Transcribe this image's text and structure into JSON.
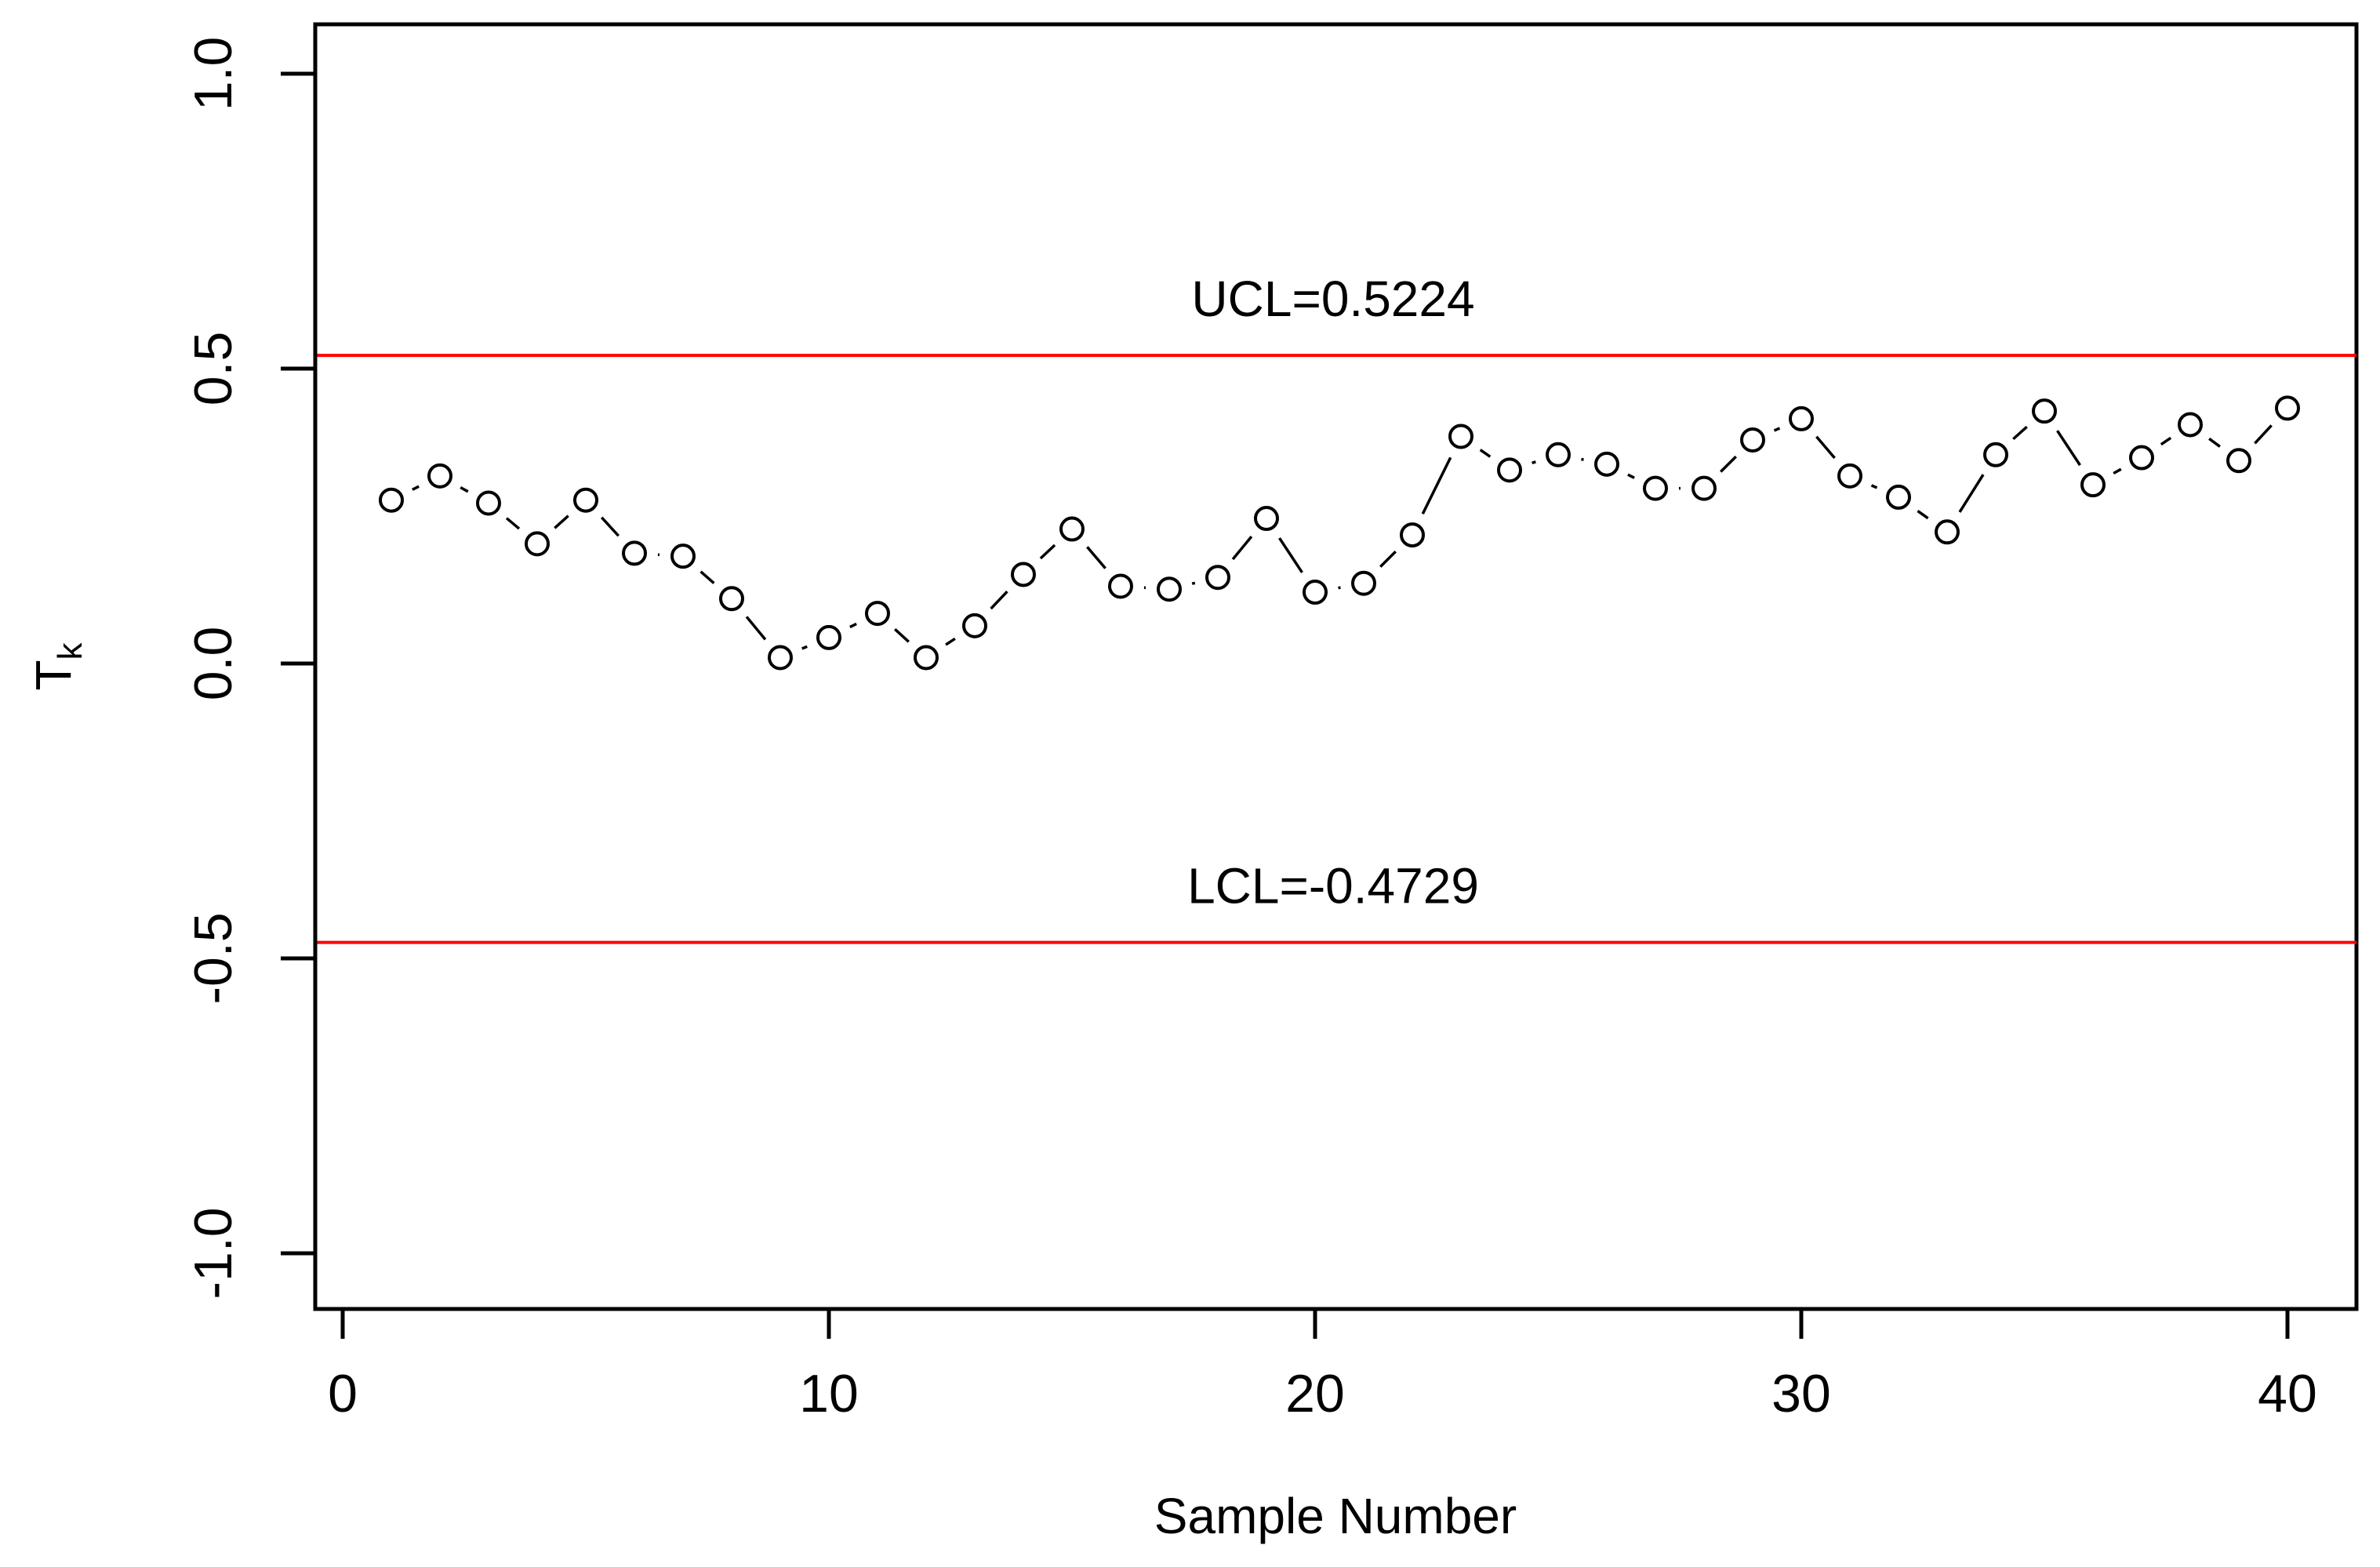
{
  "chart_data": {
    "type": "line",
    "title": "",
    "xlabel": "Sample Number",
    "ylabel": "T",
    "ylabel_subscript": "k",
    "xlim": [
      -0.6,
      41.3
    ],
    "ylim": [
      -1.08,
      1.07
    ],
    "x_ticks": [
      0,
      10,
      20,
      30,
      40
    ],
    "x_tick_labels": [
      "0",
      "10",
      "20",
      "30",
      "40"
    ],
    "y_ticks": [
      -1.0,
      -0.5,
      0.0,
      0.5,
      1.0
    ],
    "y_tick_labels": [
      "-1.0",
      "-0.5",
      "0.0",
      "0.5",
      "1.0"
    ],
    "grid": false,
    "series": [
      {
        "name": "T_k",
        "style": "points-and-lines",
        "marker": "open-circle",
        "color": "#000000",
        "x": [
          1,
          2,
          3,
          4,
          5,
          6,
          7,
          8,
          9,
          10,
          11,
          12,
          13,
          14,
          15,
          16,
          17,
          18,
          19,
          20,
          21,
          22,
          23,
          24,
          25,
          26,
          27,
          28,
          29,
          30,
          31,
          32,
          33,
          34,
          35,
          36,
          37,
          38,
          39,
          40
        ],
        "values": [
          0.277,
          0.318,
          0.272,
          0.203,
          0.277,
          0.187,
          0.182,
          0.11,
          0.01,
          0.044,
          0.085,
          0.01,
          0.064,
          0.151,
          0.228,
          0.131,
          0.126,
          0.146,
          0.246,
          0.121,
          0.136,
          0.218,
          0.385,
          0.328,
          0.354,
          0.338,
          0.297,
          0.297,
          0.379,
          0.415,
          0.318,
          0.282,
          0.223,
          0.354,
          0.428,
          0.303,
          0.349,
          0.405,
          0.344,
          0.433
        ]
      }
    ],
    "control_limits": [
      {
        "name": "UCL",
        "value": 0.5224,
        "label": "UCL=0.5224",
        "color": "#ff0000"
      },
      {
        "name": "LCL",
        "value": -0.4729,
        "label": "LCL=-0.4729",
        "color": "#ff0000"
      }
    ]
  }
}
